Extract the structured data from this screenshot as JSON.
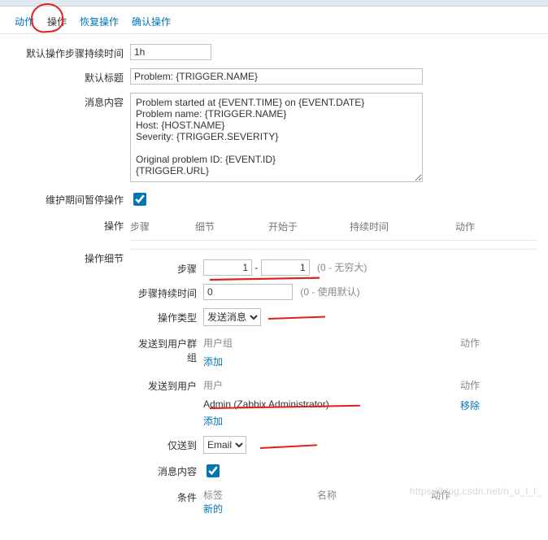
{
  "tabs": {
    "action": "动作",
    "operations": "操作",
    "recovery": "恢复操作",
    "ack": "确认操作"
  },
  "labels": {
    "defaultDuration": "默认操作步骤持续时间",
    "defaultSubject": "默认标题",
    "defaultMessage": "消息内容",
    "pauseMaint": "维护期间暂停操作",
    "operations": "操作",
    "opDetails": "操作细节",
    "steps": "步骤",
    "stepDuration": "步骤持续时间",
    "opType": "操作类型",
    "sendToGroups": "发送到用户群组",
    "sendToUsers": "发送到用户",
    "sendOnlyTo": "仅送到",
    "msgContent": "消息内容",
    "conditions": "条件"
  },
  "stepsHeader": {
    "c1": "步骤",
    "c2": "细节",
    "c3": "开始于",
    "c4": "持续时间",
    "c5": "动作"
  },
  "values": {
    "duration": "1h",
    "subject": "Problem: {TRIGGER.NAME}",
    "message": "Problem started at {EVENT.TIME} on {EVENT.DATE}\nProblem name: {TRIGGER.NAME}\nHost: {HOST.NAME}\nSeverity: {TRIGGER.SEVERITY}\n\nOriginal problem ID: {EVENT.ID}\n{TRIGGER.URL}",
    "stepFrom": "1",
    "stepTo": "1",
    "stepDur": "0",
    "opType": "发送消息",
    "sendOnlyTo": "Email"
  },
  "hints": {
    "infinity": "(0 - 无穷大)",
    "useDefault": "(0 - 使用默认)"
  },
  "subcols": {
    "userGroup": "用户组",
    "user": "用户",
    "action": "动作"
  },
  "userRow": {
    "name": "Admin (Zabbix Administrator)"
  },
  "links": {
    "add": "添加",
    "remove": "移除",
    "new": "新的"
  },
  "condHdr": {
    "label": "标签",
    "name": "名称",
    "action": "动作"
  },
  "watermark": "https://blog.csdn.net/n_u_l_l_"
}
